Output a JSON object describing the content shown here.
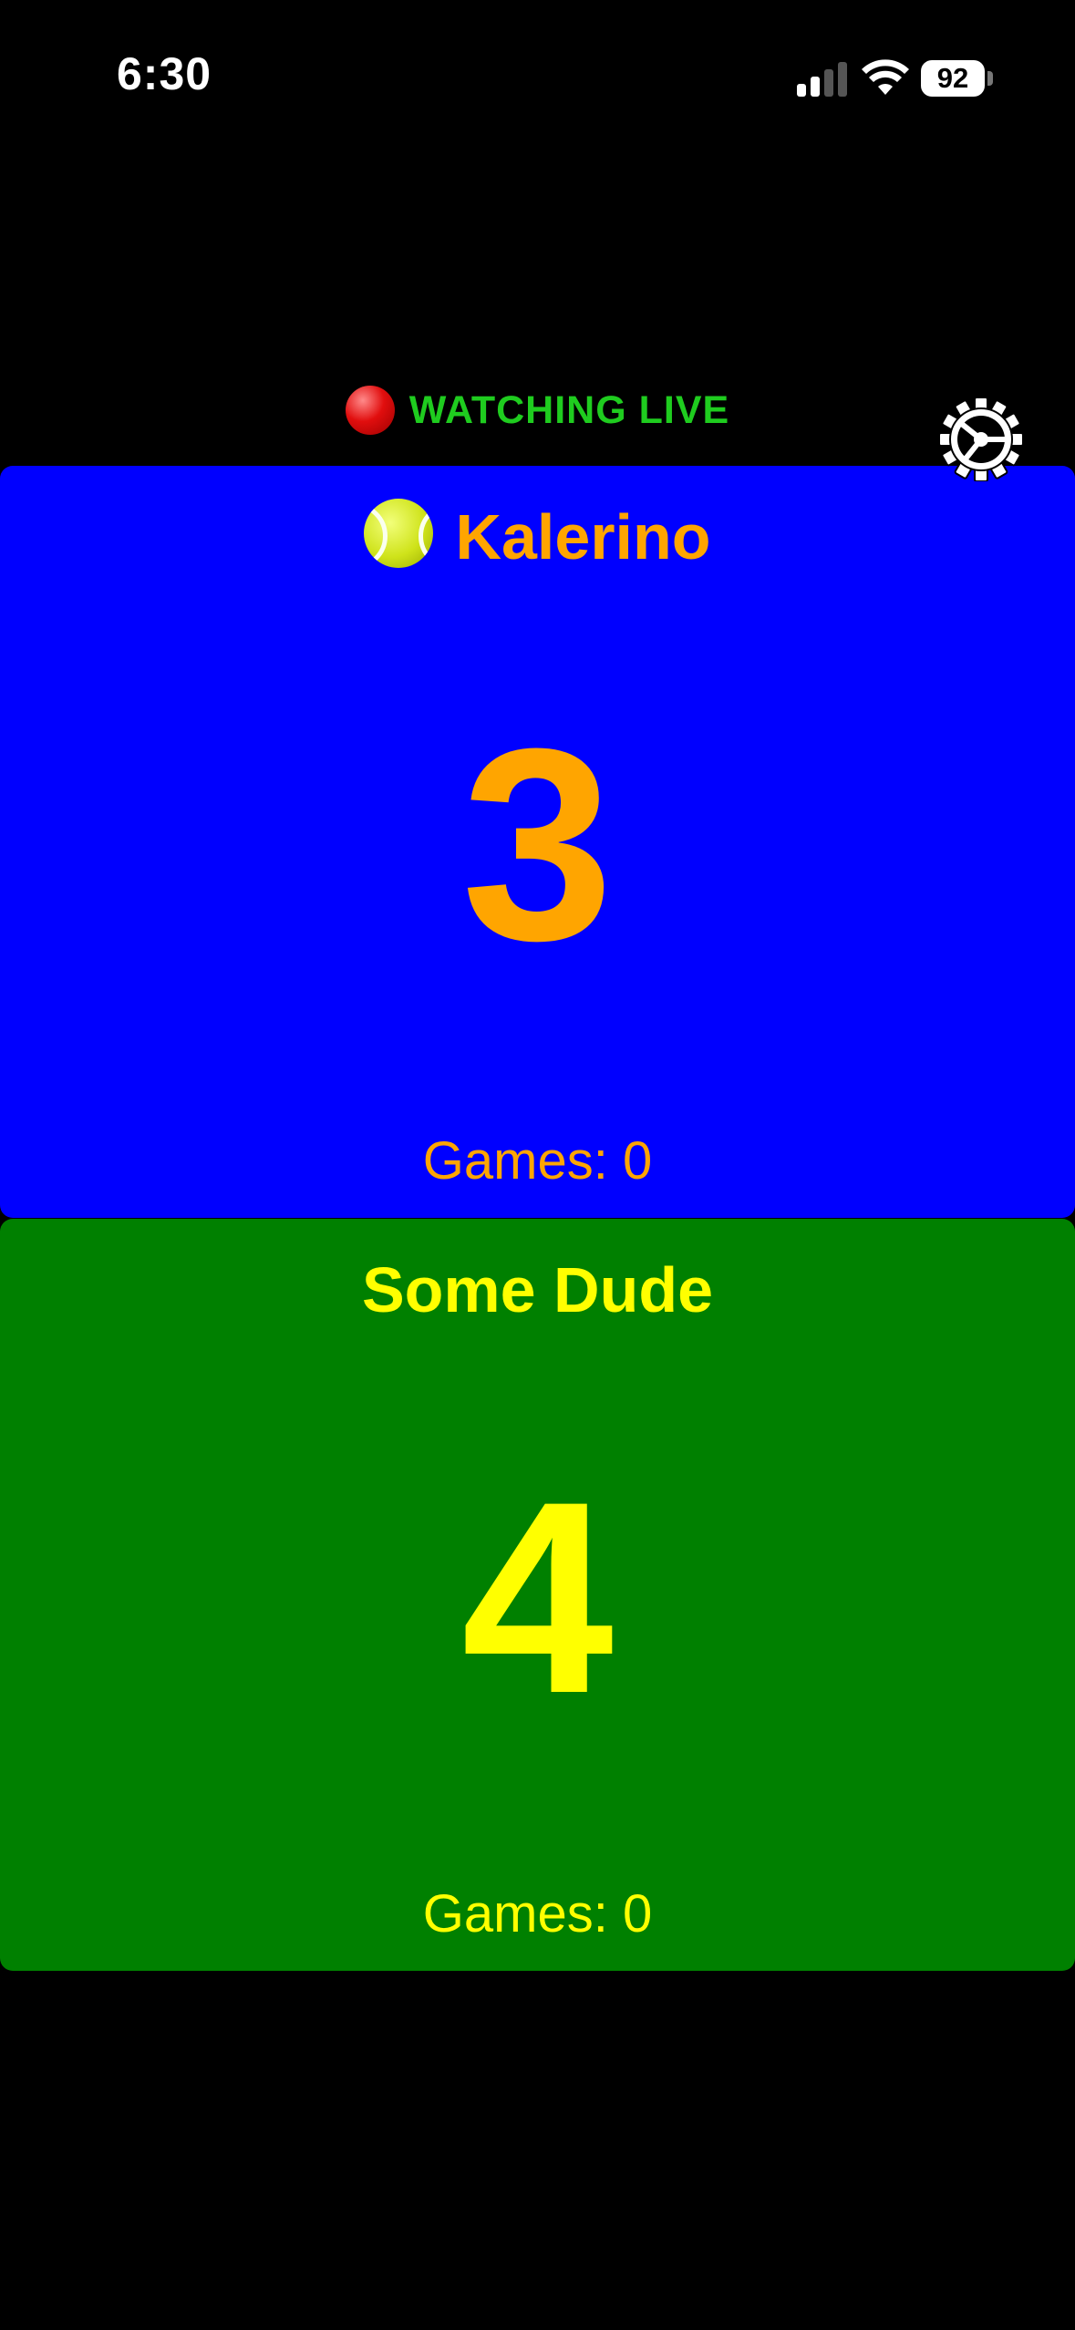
{
  "status_bar": {
    "time": "6:30",
    "battery": "92"
  },
  "header": {
    "live_label": "WATCHING LIVE",
    "live_icon": "red-circle-icon",
    "settings_icon": "gear-icon"
  },
  "players": [
    {
      "name": "Kalerino",
      "serving": true,
      "points": "3",
      "games_label": "Games: 0",
      "background": "#0000ff",
      "text_color": "#ffa500"
    },
    {
      "name": "Some Dude",
      "serving": false,
      "points": "4",
      "games_label": "Games: 0",
      "background": "#008000",
      "text_color": "#ffff00"
    }
  ],
  "colors": {
    "page_background": "#000000",
    "live_text": "#1fcc1f"
  }
}
